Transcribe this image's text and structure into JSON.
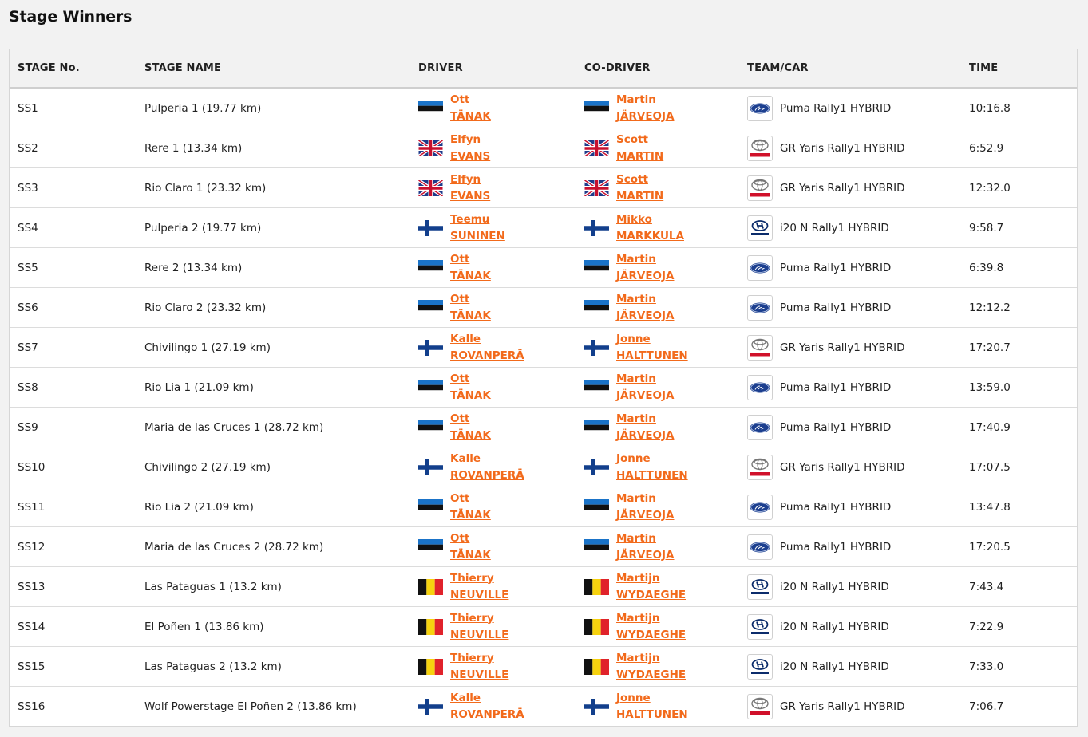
{
  "page_title": "Stage Winners",
  "headers": {
    "stage_no": "STAGE No.",
    "stage_name": "STAGE NAME",
    "driver": "DRIVER",
    "co_driver": "CO-DRIVER",
    "team_car": "TEAM/CAR",
    "time": "TIME"
  },
  "colors": {
    "link": "#f26a1b",
    "header_bg": "#f2f2f2"
  },
  "rows": [
    {
      "stage": "SS1",
      "name": "Pulperia 1 (19.77 km)",
      "driver_flag": "estonia-flag",
      "driver_first": "Ott",
      "driver_last": "TÄNAK",
      "co_flag": "estonia-flag",
      "co_first": "Martin",
      "co_last": "JÄRVEOJA",
      "team_logo": "ford-logo",
      "car": "Puma Rally1 HYBRID",
      "time": "10:16.8"
    },
    {
      "stage": "SS2",
      "name": "Rere 1 (13.34 km)",
      "driver_flag": "uk-flag",
      "driver_first": "Elfyn",
      "driver_last": "EVANS",
      "co_flag": "uk-flag",
      "co_first": "Scott",
      "co_last": "MARTIN",
      "team_logo": "toyota-logo",
      "car": "GR Yaris Rally1 HYBRID",
      "time": "6:52.9"
    },
    {
      "stage": "SS3",
      "name": "Rio Claro 1 (23.32 km)",
      "driver_flag": "uk-flag",
      "driver_first": "Elfyn",
      "driver_last": "EVANS",
      "co_flag": "uk-flag",
      "co_first": "Scott",
      "co_last": "MARTIN",
      "team_logo": "toyota-logo",
      "car": "GR Yaris Rally1 HYBRID",
      "time": "12:32.0"
    },
    {
      "stage": "SS4",
      "name": "Pulperia 2 (19.77 km)",
      "driver_flag": "finland-flag",
      "driver_first": "Teemu",
      "driver_last": "SUNINEN",
      "co_flag": "finland-flag",
      "co_first": "Mikko",
      "co_last": "MARKKULA",
      "team_logo": "hyundai-logo",
      "car": "i20 N Rally1 HYBRID",
      "time": "9:58.7"
    },
    {
      "stage": "SS5",
      "name": "Rere 2 (13.34 km)",
      "driver_flag": "estonia-flag",
      "driver_first": "Ott",
      "driver_last": "TÄNAK",
      "co_flag": "estonia-flag",
      "co_first": "Martin",
      "co_last": "JÄRVEOJA",
      "team_logo": "ford-logo",
      "car": "Puma Rally1 HYBRID",
      "time": "6:39.8"
    },
    {
      "stage": "SS6",
      "name": "Rio Claro 2 (23.32 km)",
      "driver_flag": "estonia-flag",
      "driver_first": "Ott",
      "driver_last": "TÄNAK",
      "co_flag": "estonia-flag",
      "co_first": "Martin",
      "co_last": "JÄRVEOJA",
      "team_logo": "ford-logo",
      "car": "Puma Rally1 HYBRID",
      "time": "12:12.2"
    },
    {
      "stage": "SS7",
      "name": "Chivilingo 1 (27.19 km)",
      "driver_flag": "finland-flag",
      "driver_first": "Kalle",
      "driver_last": "ROVANPERÄ",
      "co_flag": "finland-flag",
      "co_first": "Jonne",
      "co_last": "HALTTUNEN",
      "team_logo": "toyota-logo",
      "car": "GR Yaris Rally1 HYBRID",
      "time": "17:20.7"
    },
    {
      "stage": "SS8",
      "name": "Rio Lia 1 (21.09 km)",
      "driver_flag": "estonia-flag",
      "driver_first": "Ott",
      "driver_last": "TÄNAK",
      "co_flag": "estonia-flag",
      "co_first": "Martin",
      "co_last": "JÄRVEOJA",
      "team_logo": "ford-logo",
      "car": "Puma Rally1 HYBRID",
      "time": "13:59.0"
    },
    {
      "stage": "SS9",
      "name": "Maria de las Cruces 1 (28.72 km)",
      "driver_flag": "estonia-flag",
      "driver_first": "Ott",
      "driver_last": "TÄNAK",
      "co_flag": "estonia-flag",
      "co_first": "Martin",
      "co_last": "JÄRVEOJA",
      "team_logo": "ford-logo",
      "car": "Puma Rally1 HYBRID",
      "time": "17:40.9"
    },
    {
      "stage": "SS10",
      "name": "Chivilingo 2 (27.19 km)",
      "driver_flag": "finland-flag",
      "driver_first": "Kalle",
      "driver_last": "ROVANPERÄ",
      "co_flag": "finland-flag",
      "co_first": "Jonne",
      "co_last": "HALTTUNEN",
      "team_logo": "toyota-logo",
      "car": "GR Yaris Rally1 HYBRID",
      "time": "17:07.5"
    },
    {
      "stage": "SS11",
      "name": "Rio Lia 2 (21.09 km)",
      "driver_flag": "estonia-flag",
      "driver_first": "Ott",
      "driver_last": "TÄNAK",
      "co_flag": "estonia-flag",
      "co_first": "Martin",
      "co_last": "JÄRVEOJA",
      "team_logo": "ford-logo",
      "car": "Puma Rally1 HYBRID",
      "time": "13:47.8"
    },
    {
      "stage": "SS12",
      "name": "Maria de las Cruces 2 (28.72 km)",
      "driver_flag": "estonia-flag",
      "driver_first": "Ott",
      "driver_last": "TÄNAK",
      "co_flag": "estonia-flag",
      "co_first": "Martin",
      "co_last": "JÄRVEOJA",
      "team_logo": "ford-logo",
      "car": "Puma Rally1 HYBRID",
      "time": "17:20.5"
    },
    {
      "stage": "SS13",
      "name": "Las Pataguas 1 (13.2 km)",
      "driver_flag": "belgium-flag",
      "driver_first": "Thierry",
      "driver_last": "NEUVILLE",
      "co_flag": "belgium-flag",
      "co_first": "Martijn",
      "co_last": "WYDAEGHE",
      "team_logo": "hyundai-logo",
      "car": "i20 N Rally1 HYBRID",
      "time": "7:43.4"
    },
    {
      "stage": "SS14",
      "name": "El Poñen 1 (13.86 km)",
      "driver_flag": "belgium-flag",
      "driver_first": "Thierry",
      "driver_last": "NEUVILLE",
      "co_flag": "belgium-flag",
      "co_first": "Martijn",
      "co_last": "WYDAEGHE",
      "team_logo": "hyundai-logo",
      "car": "i20 N Rally1 HYBRID",
      "time": "7:22.9"
    },
    {
      "stage": "SS15",
      "name": "Las Pataguas 2 (13.2 km)",
      "driver_flag": "belgium-flag",
      "driver_first": "Thierry",
      "driver_last": "NEUVILLE",
      "co_flag": "belgium-flag",
      "co_first": "Martijn",
      "co_last": "WYDAEGHE",
      "team_logo": "hyundai-logo",
      "car": "i20 N Rally1 HYBRID",
      "time": "7:33.0"
    },
    {
      "stage": "SS16",
      "name": "Wolf Powerstage El Poñen 2 (13.86 km)",
      "driver_flag": "finland-flag",
      "driver_first": "Kalle",
      "driver_last": "ROVANPERÄ",
      "co_flag": "finland-flag",
      "co_first": "Jonne",
      "co_last": "HALTTUNEN",
      "team_logo": "toyota-logo",
      "car": "GR Yaris Rally1 HYBRID",
      "time": "7:06.7"
    }
  ]
}
